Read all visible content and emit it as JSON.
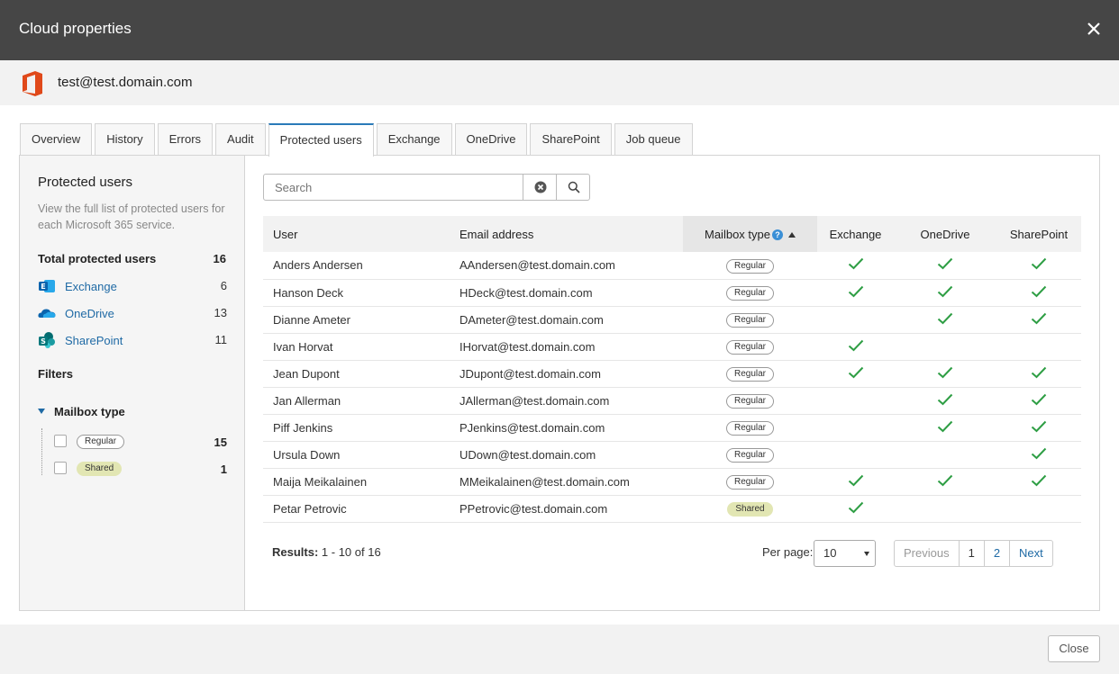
{
  "window": {
    "title": "Cloud properties"
  },
  "account": {
    "name": "test@test.domain.com"
  },
  "tabs": [
    {
      "label": "Overview"
    },
    {
      "label": "History"
    },
    {
      "label": "Errors"
    },
    {
      "label": "Audit"
    },
    {
      "label": "Protected users",
      "active": true
    },
    {
      "label": "Exchange"
    },
    {
      "label": "OneDrive"
    },
    {
      "label": "SharePoint"
    },
    {
      "label": "Job queue"
    }
  ],
  "sidebar": {
    "title": "Protected users",
    "description": "View the full list of protected users for each Microsoft 365 service.",
    "total_label": "Total protected users",
    "total_count": "16",
    "services": [
      {
        "label": "Exchange",
        "count": "6",
        "icon": "exchange-icon"
      },
      {
        "label": "OneDrive",
        "count": "13",
        "icon": "onedrive-icon"
      },
      {
        "label": "SharePoint",
        "count": "11",
        "icon": "sharepoint-icon"
      }
    ],
    "filters_label": "Filters",
    "filter_group": "Mailbox type",
    "filter_options": [
      {
        "label": "Regular",
        "count": "15"
      },
      {
        "label": "Shared",
        "count": "1"
      }
    ]
  },
  "search": {
    "placeholder": "Search"
  },
  "table": {
    "headers": {
      "user": "User",
      "email": "Email address",
      "mailbox": "Mailbox type",
      "exchange": "Exchange",
      "onedrive": "OneDrive",
      "sharepoint": "SharePoint"
    },
    "rows": [
      {
        "user": "Anders Andersen",
        "email": "AAndersen@test.domain.com",
        "mailbox": "Regular",
        "exchange": true,
        "onedrive": true,
        "sharepoint": true
      },
      {
        "user": "Hanson Deck",
        "email": "HDeck@test.domain.com",
        "mailbox": "Regular",
        "exchange": true,
        "onedrive": true,
        "sharepoint": true
      },
      {
        "user": "Dianne Ameter",
        "email": "DAmeter@test.domain.com",
        "mailbox": "Regular",
        "exchange": false,
        "onedrive": true,
        "sharepoint": true
      },
      {
        "user": "Ivan Horvat",
        "email": "IHorvat@test.domain.com",
        "mailbox": "Regular",
        "exchange": true,
        "onedrive": false,
        "sharepoint": false
      },
      {
        "user": "Jean Dupont",
        "email": "JDupont@test.domain.com",
        "mailbox": "Regular",
        "exchange": true,
        "onedrive": true,
        "sharepoint": true
      },
      {
        "user": "Jan Allerman",
        "email": "JAllerman@test.domain.com",
        "mailbox": "Regular",
        "exchange": false,
        "onedrive": true,
        "sharepoint": true
      },
      {
        "user": "Piff Jenkins",
        "email": "PJenkins@test.domain.com",
        "mailbox": "Regular",
        "exchange": false,
        "onedrive": true,
        "sharepoint": true
      },
      {
        "user": "Ursula Down",
        "email": "UDown@test.domain.com",
        "mailbox": "Regular",
        "exchange": false,
        "onedrive": false,
        "sharepoint": true
      },
      {
        "user": "Maija Meikalainen",
        "email": "MMeikalainen@test.domain.com",
        "mailbox": "Regular",
        "exchange": true,
        "onedrive": true,
        "sharepoint": true
      },
      {
        "user": "Petar Petrovic",
        "email": "PPetrovic@test.domain.com",
        "mailbox": "Shared",
        "exchange": true,
        "onedrive": false,
        "sharepoint": false
      }
    ]
  },
  "results": {
    "label": "Results:",
    "range": "1 - 10 of 16"
  },
  "per_page": {
    "label": "Per page:",
    "value": "10"
  },
  "pagination": {
    "previous": "Previous",
    "pages": [
      "1",
      "2"
    ],
    "next": "Next"
  },
  "footer": {
    "close_label": "Close"
  },
  "colors": {
    "accent": "#1f6aa5",
    "check": "#2e9e44",
    "titlebar": "#464646",
    "shared_badge": "#e2e6b3"
  }
}
